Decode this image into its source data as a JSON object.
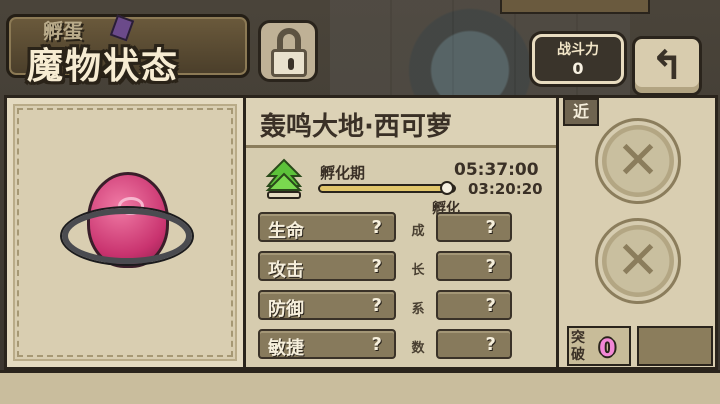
{
  "header": {
    "title": "魔物状态",
    "subtitle_fragment": "孵蛋",
    "power_label": "战斗力",
    "power_value": "0",
    "back_glyph": "↰"
  },
  "monster": {
    "name": "轰鸣大地·西可萝",
    "stage_label": "孵化期",
    "hatch_time": "05:37:00",
    "remaining_time": "03:20:20",
    "hatch_action": "孵化",
    "hatch_progress": 0.95
  },
  "stats": [
    {
      "name": "生命",
      "value": "?",
      "growth": "?",
      "growth_char": "成"
    },
    {
      "name": "攻击",
      "value": "?",
      "growth": "?",
      "growth_char": "长"
    },
    {
      "name": "防御",
      "value": "?",
      "growth": "?",
      "growth_char": "系"
    },
    {
      "name": "敏捷",
      "value": "?",
      "growth": "?",
      "growth_char": "数"
    }
  ],
  "equipment": {
    "tag": "近",
    "slot_glyph": "✕",
    "break_label": "突破",
    "break_value": "0"
  },
  "colors": {
    "egg": "#c9336f",
    "break_value": "#f287d6",
    "hatch_arrow": "#5cc23a"
  },
  "icons": [
    "lock-icon",
    "back-arrow-icon",
    "hatch-arrow-icon",
    "close-icon"
  ]
}
